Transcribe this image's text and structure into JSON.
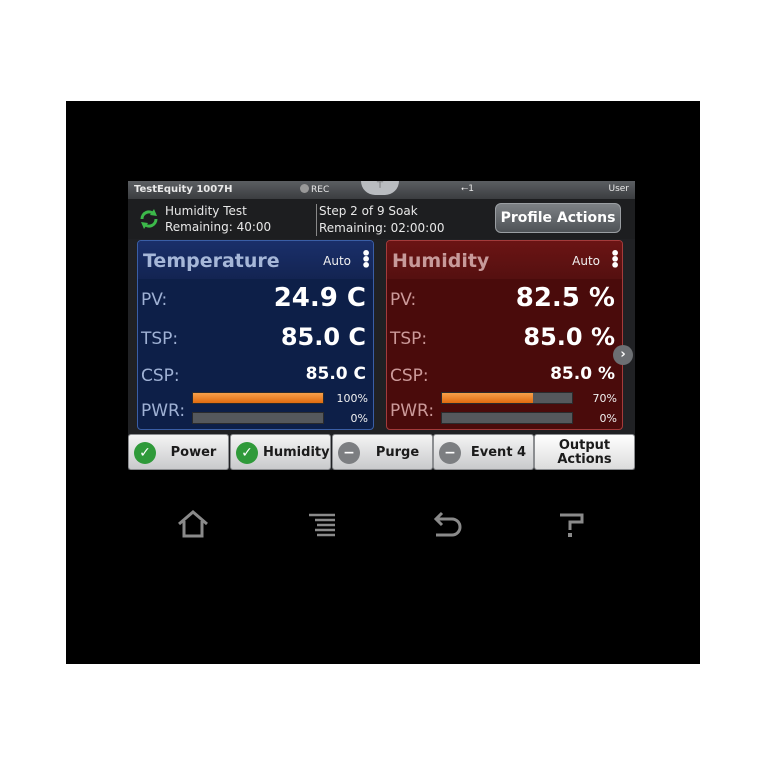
{
  "status_bar": {
    "model": "TestEquity 1007H",
    "rec_label": "REC",
    "usb_count": "1",
    "user_label": "User"
  },
  "profile": {
    "name": "Humidity Test",
    "remaining": "Remaining: 40:00",
    "step": "Step 2 of 9 Soak",
    "step_remaining": "Remaining: 02:00:00",
    "actions_label": "Profile Actions",
    "icon": "cycle-arrows-icon",
    "icon_color": "#3cb94a"
  },
  "temperature": {
    "title": "Temperature",
    "mode": "Auto",
    "pv_label": "PV:",
    "pv_value": "24.9 C",
    "tsp_label": "TSP:",
    "tsp_value": "85.0 C",
    "csp_label": "CSP:",
    "csp_value": "85.0 C",
    "pwr_label": "PWR:",
    "pwr1_pct": "100%",
    "pwr1_fraction": 1.0,
    "pwr2_pct": "0%",
    "pwr2_fraction": 0.0,
    "accent": "#1a2f6a"
  },
  "humidity": {
    "title": "Humidity",
    "mode": "Auto",
    "pv_label": "PV:",
    "pv_value": "82.5 %",
    "tsp_label": "TSP:",
    "tsp_value": "85.0 %",
    "csp_label": "CSP:",
    "csp_value": "85.0 %",
    "pwr_label": "PWR:",
    "pwr1_pct": "70%",
    "pwr1_fraction": 0.7,
    "pwr2_pct": "0%",
    "pwr2_fraction": 0.0,
    "accent": "#6b1414"
  },
  "outputs": [
    {
      "label": "Power",
      "state": "on",
      "icon": "check-icon"
    },
    {
      "label": "Humidity",
      "state": "on",
      "icon": "check-icon"
    },
    {
      "label": "Purge",
      "state": "off",
      "icon": "minus-icon"
    },
    {
      "label": "Event 4",
      "state": "off",
      "icon": "minus-icon"
    }
  ],
  "output_actions": {
    "line1": "Output",
    "line2": "Actions"
  },
  "hardware_buttons": [
    {
      "name": "home-icon"
    },
    {
      "name": "menu-icon"
    },
    {
      "name": "back-icon"
    },
    {
      "name": "help-icon"
    }
  ],
  "colors": {
    "bar_fill": "#e8791c",
    "on_green": "#2f9a3a"
  }
}
